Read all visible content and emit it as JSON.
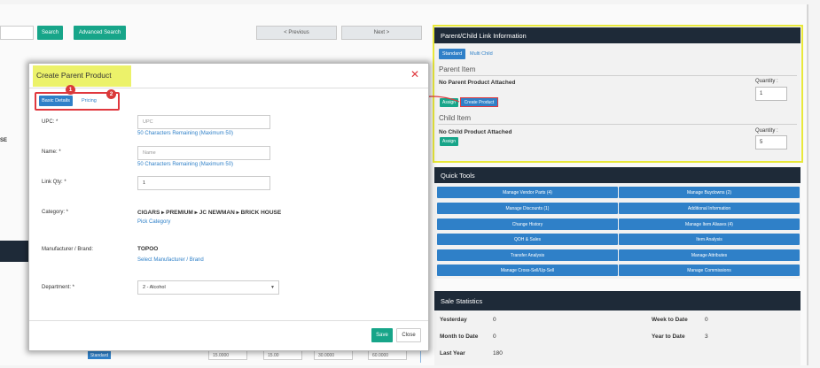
{
  "background": {
    "search_label": "Search",
    "advanced_search_label": "Advanced Search",
    "previous_label": "< Previous",
    "next_label": "Next >",
    "left_fragment": "SE",
    "bottom_standard": "Standard",
    "bottom_values": [
      "15.0000",
      "15.00",
      "30.0000",
      "60.0000"
    ]
  },
  "parent_child": {
    "title": "Parent/Child Link Information",
    "tab_standard": "Standard",
    "tab_multi": "Multi Child",
    "parent_heading": "Parent Item",
    "no_parent": "No Parent Product Attached",
    "parent_qty_label": "Quantity :",
    "parent_qty_value": "1",
    "assign_label": "Assign",
    "create_product_label": "Create Product",
    "child_heading": "Child Item",
    "no_child": "No Child Product Attached",
    "child_qty_label": "Quantity :",
    "child_qty_value": "5"
  },
  "quick_tools": {
    "title": "Quick Tools",
    "buttons": [
      "Manage Vendor Parts (4)",
      "Manage Buydowns (2)",
      "Manage Discounts (1)",
      "Additional Information",
      "Change History",
      "Manage Item Aliases (4)",
      "QOH & Sales",
      "Item Analysis",
      "Transfer Analysis",
      "Manage Attributes",
      "Manage Cross-Sell/Up-Sell",
      "Manage Commissions"
    ]
  },
  "sale_stats": {
    "title": "Sale Statistics",
    "rows": [
      {
        "label": "Yesterday",
        "value": "0",
        "label2": "Week to Date",
        "value2": "0"
      },
      {
        "label": "Month to Date",
        "value": "0",
        "label2": "Year to Date",
        "value2": "3"
      },
      {
        "label": "Last Year",
        "value": "180"
      }
    ]
  },
  "modal": {
    "title": "Create Parent Product",
    "close_glyph": "✕",
    "tab_basic": "Basic Details",
    "tab_pricing": "Pricing",
    "badge1": "1",
    "badge2": "2",
    "upc_label": "UPC: *",
    "upc_placeholder": "UPC",
    "upc_hint": "50 Characters Remaining (Maximum 50)",
    "name_label": "Name: *",
    "name_placeholder": "Name",
    "name_hint": "50 Characters Remaining (Maximum 50)",
    "link_qty_label": "Link Qty: *",
    "link_qty_value": "1",
    "category_label": "Category: *",
    "category_value": "CIGARS ▸ PREMIUM ▸ JC NEWMAN ▸ BRICK HOUSE",
    "pick_category": "Pick Category",
    "manufacturer_label": "Manufacturer / Brand:",
    "manufacturer_value": "TOPOO",
    "select_manufacturer": "Select Manufacturer / Brand",
    "department_label": "Department: *",
    "department_value": "2 - Alcohol",
    "save_label": "Save",
    "close_label": "Close"
  }
}
